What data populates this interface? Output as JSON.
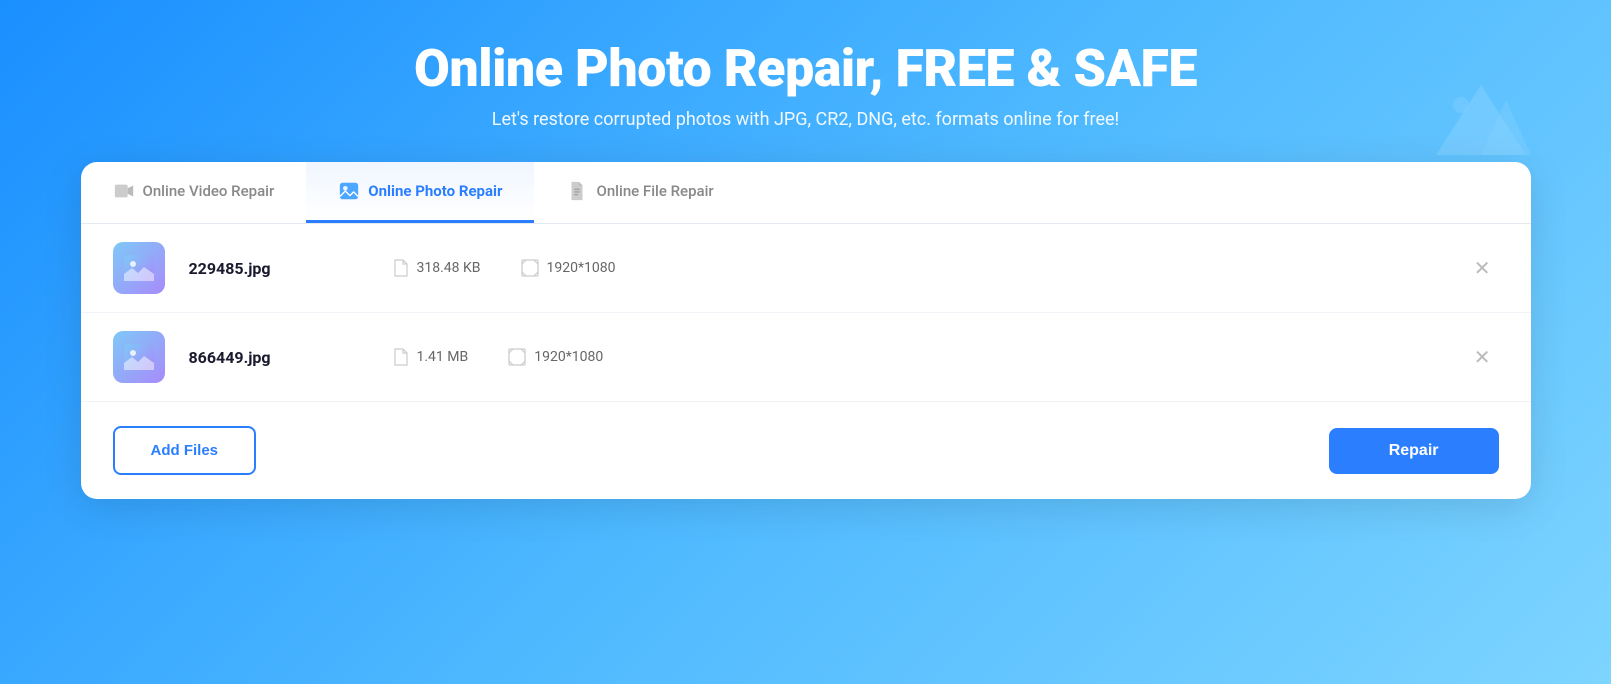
{
  "hero": {
    "title": "Online Photo Repair, FREE & SAFE",
    "subtitle": "Let's restore corrupted photos with JPG, CR2, DNG, etc. formats online for free!"
  },
  "tabs": [
    {
      "id": "video",
      "label": "Online Video Repair",
      "active": false
    },
    {
      "id": "photo",
      "label": "Online Photo Repair",
      "active": true
    },
    {
      "id": "file",
      "label": "Online File Repair",
      "active": false
    }
  ],
  "files": [
    {
      "name": "229485.jpg",
      "size": "318.48 KB",
      "dimensions": "1920*1080"
    },
    {
      "name": "866449.jpg",
      "size": "1.41 MB",
      "dimensions": "1920*1080"
    }
  ],
  "buttons": {
    "add_files": "Add Files",
    "repair": "Repair"
  }
}
